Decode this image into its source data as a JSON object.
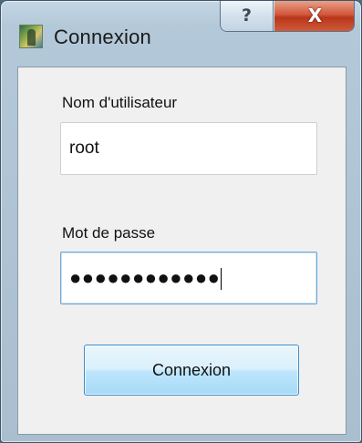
{
  "window": {
    "title": "Connexion",
    "help_glyph": "?",
    "close_glyph": "X"
  },
  "form": {
    "username_label": "Nom d'utilisateur",
    "username_value": "root",
    "password_label": "Mot de passe",
    "password_masked": "●●●●●●●●●●●●",
    "submit_label": "Connexion"
  },
  "icons": {
    "app": "app-icon",
    "help": "help-icon",
    "close": "close-icon"
  },
  "colors": {
    "window_frame": "#b3c8d8",
    "close_button": "#d2583c",
    "focus_border": "#6aa6d6",
    "button_border": "#3c8fc8",
    "client_bg": "#f0f0f0"
  }
}
